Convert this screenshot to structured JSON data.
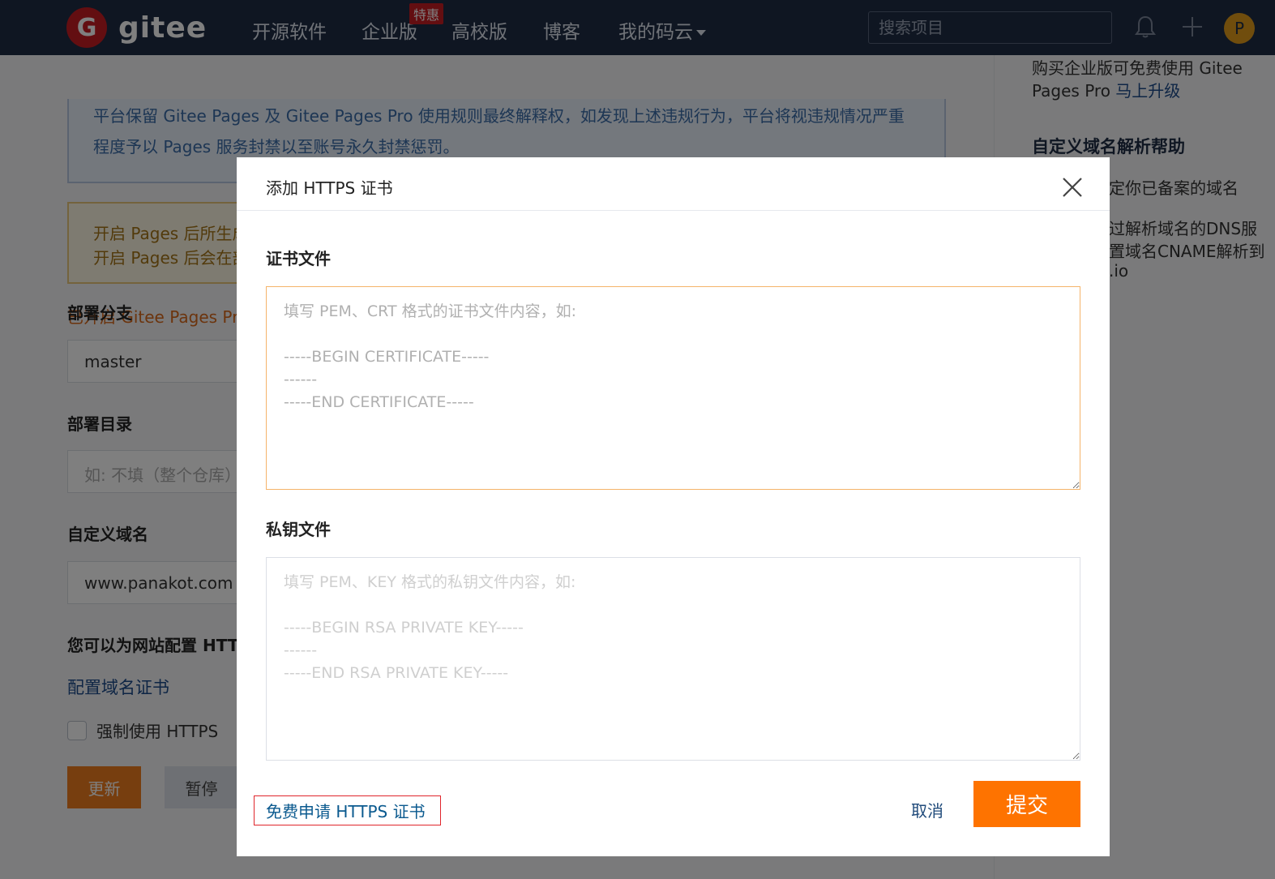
{
  "topnav": {
    "logo_text": "gitee",
    "logo_mark": "G",
    "items": [
      "开源软件",
      "企业版",
      "高校版",
      "博客",
      "我的码云"
    ],
    "badge": "特惠",
    "search_placeholder": "搜索项目",
    "avatar_letter": "P"
  },
  "background": {
    "notice_blue": "平台保留 Gitee Pages 及 Gitee Pages Pro 使用规则最终解释权，如发现上述违规行为，平台将视违规情况严重程度予以 Pages 服务封禁以至账号永久封禁惩罚。",
    "notice_yellow_lines": [
      "开启 Pages 后所生成",
      "开启 Pages 后会在部"
    ],
    "status_line": "已开启 Gitee Pages Pro",
    "branch_label": "部署分支",
    "branch_value": "master",
    "dir_label": "部署目录",
    "dir_placeholder": "如: 不填（整个仓库）",
    "domain_label": "自定义域名",
    "domain_value": "www.panakot.com",
    "https_label": "您可以为网站配置 HTTPS",
    "config_cert_link": "配置域名证书",
    "force_https_label": "强制使用 HTTPS",
    "update_button": "更新",
    "pause_button": "暂停"
  },
  "sidebar": {
    "upgrade_prefix": "购买企业版可免费使用 Gitee Pages Pro ",
    "upgrade_link": "马上升级",
    "help_heading": "自定义域名解析帮助",
    "help_line_1": "定你已备案的域名",
    "help_line_2": "过解析域名的DNS服",
    "help_line_3": "置域名CNAME解析到",
    "help_line_4": ".io"
  },
  "modal": {
    "title": "添加 HTTPS 证书",
    "cert_label": "证书文件",
    "cert_placeholder": "填写 PEM、CRT 格式的证书文件内容，如:\n\n-----BEGIN CERTIFICATE-----\n------\n-----END CERTIFICATE-----",
    "key_label": "私钥文件",
    "key_placeholder": "填写 PEM、KEY 格式的私钥文件内容，如:\n\n-----BEGIN RSA PRIVATE KEY-----\n------\n-----END RSA PRIVATE KEY-----",
    "free_cert_link": "免费申请 HTTPS 证书",
    "cancel_button": "取消",
    "submit_button": "提交"
  },
  "colors": {
    "nav_bg": "#1f2d45",
    "brand_red": "#c71d23",
    "submit_orange": "#fe7300",
    "link_blue": "#0b5a8f"
  }
}
